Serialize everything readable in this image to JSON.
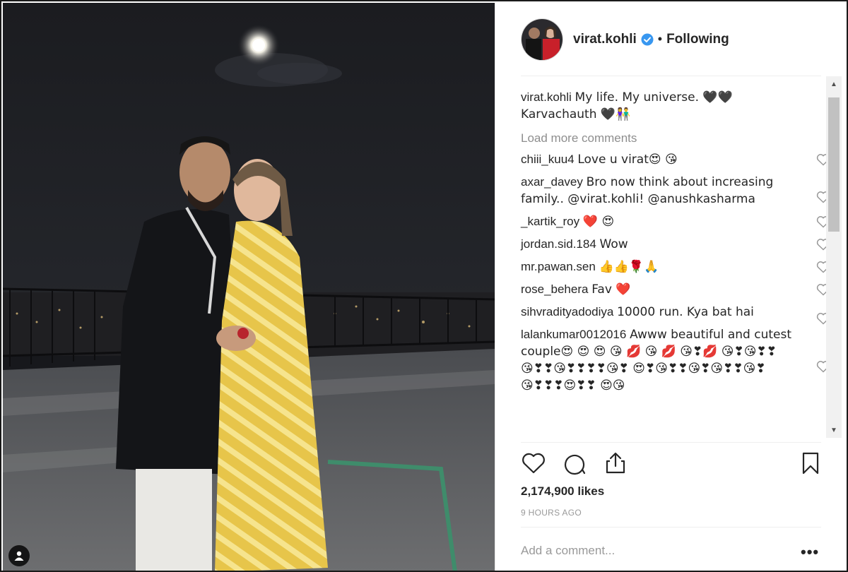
{
  "header": {
    "username": "virat.kohli",
    "separator": "•",
    "follow_status": "Following"
  },
  "caption": {
    "username": "virat.kohli",
    "text": "My life. My universe. 🖤🖤 Karvachauth 🖤👫"
  },
  "load_more_label": "Load more comments",
  "comments": [
    {
      "username": "chiii_kuu4",
      "text": "Love u virat😍 😘"
    },
    {
      "username": "axar_davey",
      "text": "Bro now think about increasing family.. @virat.kohli! @anushkasharma"
    },
    {
      "username": "_kartik_roy",
      "text": "❤️ 😍"
    },
    {
      "username": "jordan.sid.184",
      "text": "Wow"
    },
    {
      "username": "mr.pawan.sen",
      "text": "👍👍🌹🙏"
    },
    {
      "username": "rose_behera",
      "text": "Fav ❤️"
    },
    {
      "username": "sihvradityadodiya",
      "text": "10000 run. Kya bat hai"
    },
    {
      "username": "lalankumar0012016",
      "text": "Awww beautiful and cutest couple😍 😍 😍 😘 💋 😘 💋 😘❣💋 😘❣😘❣❣😘❣❣😘❣❣❣❣😘❣ 😍❣😘❣❣😘❣😘❣❣😘❣😘❣❣❣😍❣❣ 😍😘"
    }
  ],
  "likes_label": "2,174,900 likes",
  "timestamp": "9 HOURS AGO",
  "add_comment_placeholder": "Add a comment...",
  "more_options_label": "•••",
  "scroll_up_glyph": "▲",
  "scroll_down_glyph": "▼",
  "icons": {
    "like": "heart-outline-icon",
    "comment": "speech-bubble-icon",
    "share": "share-icon",
    "save": "bookmark-icon",
    "verified": "verified-badge-icon",
    "user_tag": "user-tag-icon"
  },
  "colors": {
    "verified_blue": "#3897f0",
    "text": "#262626",
    "muted": "#999999",
    "divider": "#efefef"
  }
}
